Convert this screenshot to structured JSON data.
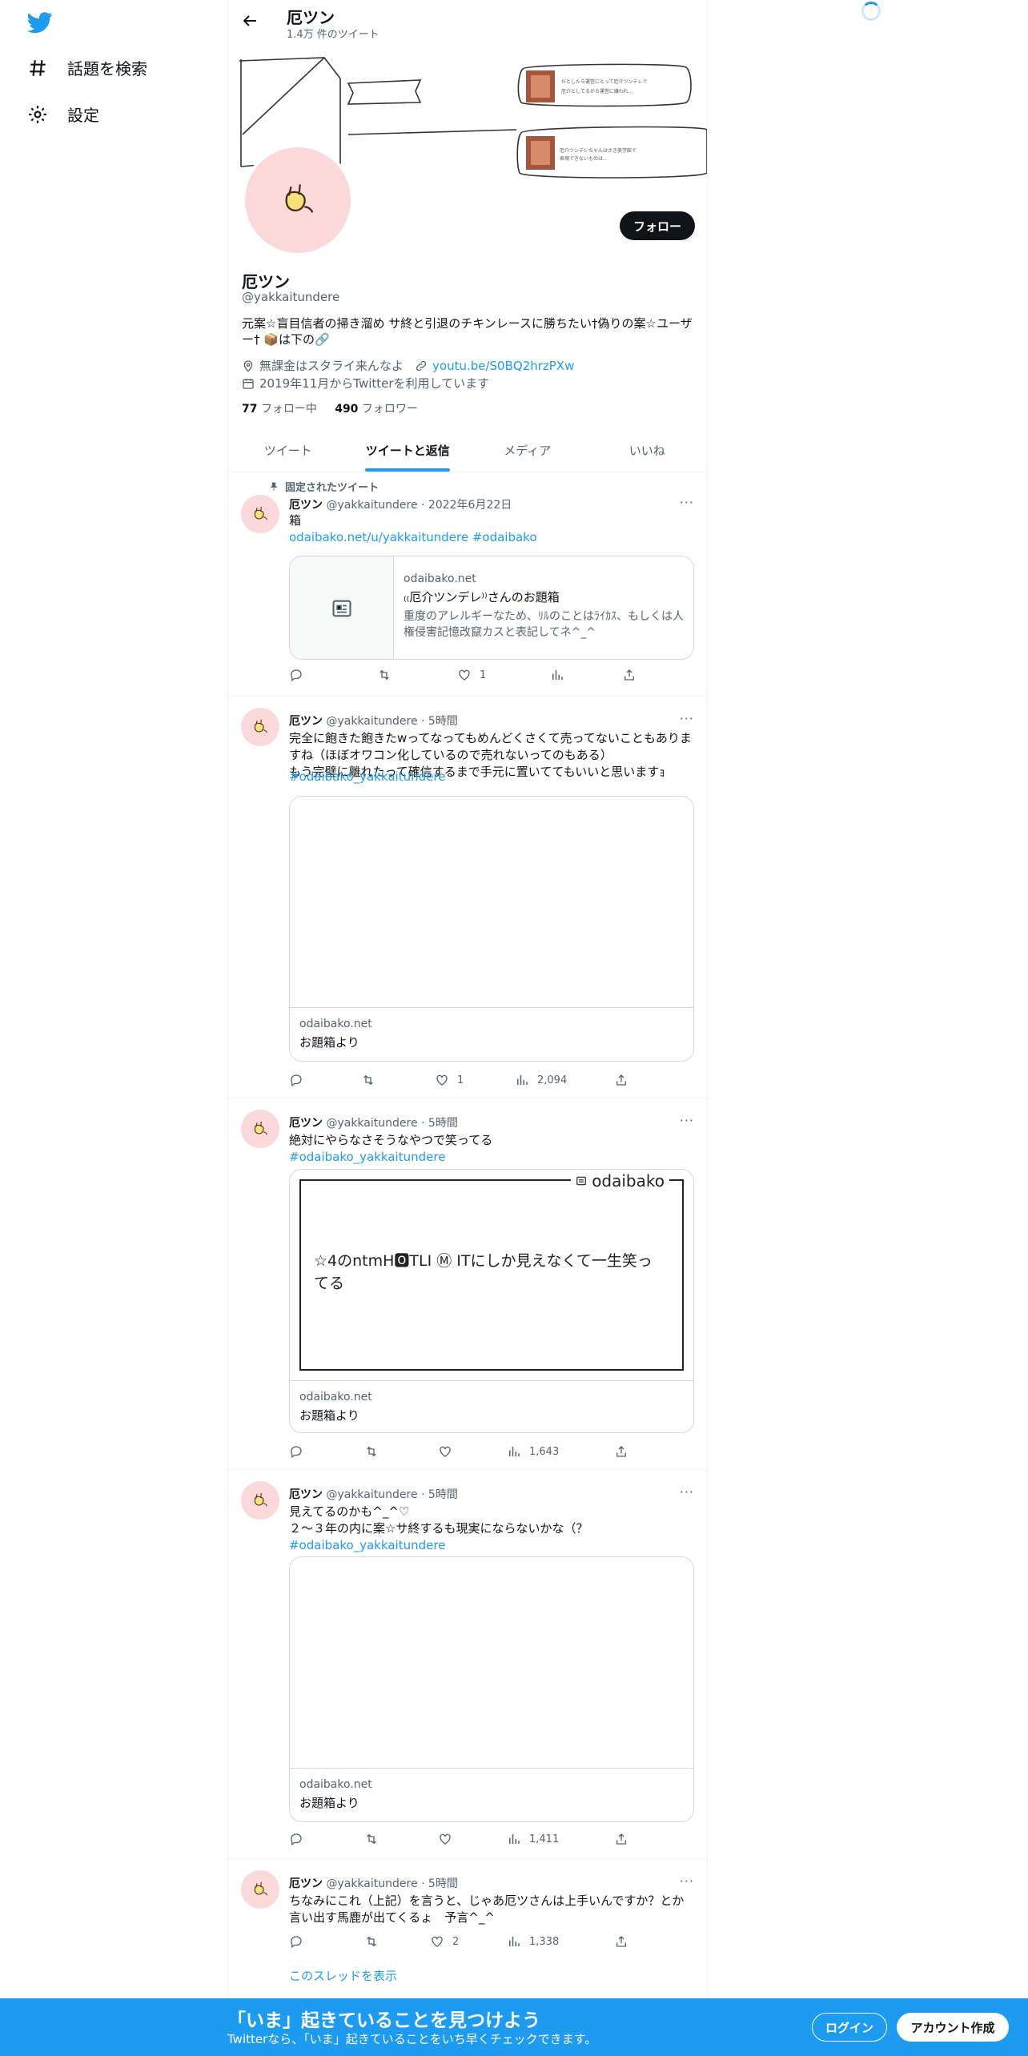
{
  "nav": {
    "items": [
      {
        "label": "話題を検索",
        "icon": "hashtag-icon"
      },
      {
        "label": "設定",
        "icon": "gear-icon"
      }
    ]
  },
  "header": {
    "title": "厄ツン",
    "tweet_count": "1.4万 件のツイート"
  },
  "profile": {
    "name": "厄ツン",
    "handle": "@yakkaitundere",
    "bio": "元案☆盲目信者の掃き溜め サ終と引退のチキンレースに勝ちたい†偽りの案☆ユーザー† 📦は下の🔗",
    "location": "無課金はスタライ来んなよ",
    "website": "youtu.be/S0BQ2hrzPXw",
    "joined": "2019年11月からTwitterを利用しています",
    "following_count": "77",
    "following_label": "フォロー中",
    "followers_count": "490",
    "followers_label": "フォロワー",
    "follow_button": "フォロー"
  },
  "tabs": [
    "ツイート",
    "ツイートと返信",
    "メディア",
    "いいね"
  ],
  "pinned_label": "固定されたツイート",
  "tweets": [
    {
      "name": "厄ツン",
      "handle": "@yakkaitundere",
      "time": "· 2022年6月22日",
      "text": "箱",
      "links": "odaibako.net/u/yakkaitundere #odaibako",
      "card_domain": "odaibako.net",
      "card_title": "₍₍厄介ツンデレ⁾⁾さんのお題箱",
      "card_desc": "重度のアレルギーなため、ﾘﾙのことはﾗｲｶｽ、もしくは人権侵害記憶改竄カスと表記してネ^_^",
      "replies": "",
      "retweets": "",
      "likes": "1",
      "views": "",
      "more": "···"
    },
    {
      "name": "厄ツン",
      "handle": "@yakkaitundere",
      "time": "· 5時間",
      "text": "完全に飽きた飽きたwってなってもめんどくさくて売ってないこともありますね（ほぼオワコン化しているので売れないってのもある）\nもう完璧に離れたって確信するまで手元に置いててもいいと思いますｮ",
      "links": "#odaibako_yakkaitundere",
      "card_domain": "odaibako.net",
      "card_title": "お題箱より",
      "replies": "",
      "retweets": "",
      "likes": "1",
      "views": "2,094",
      "more": "···"
    },
    {
      "name": "厄ツン",
      "handle": "@yakkaitundere",
      "time": "· 5時間",
      "text": "絶対にやらなさそうなやつで笑ってる",
      "links": "#odaibako_yakkaitundere",
      "card_image_brand": "odaibako",
      "card_image_text": "☆4のntmH🅾TLI Ⓜ ITにしか見えなくて一生笑ってる",
      "card_domain": "odaibako.net",
      "card_title": "お題箱より",
      "replies": "",
      "retweets": "",
      "likes": "",
      "views": "1,643",
      "more": "···"
    },
    {
      "name": "厄ツン",
      "handle": "@yakkaitundere",
      "time": "· 5時間",
      "text": "見えてるのかも^_^♡\n２〜３年の内に案☆サ終するも現実にならないかな（？",
      "links": "#odaibako_yakkaitundere",
      "card_domain": "odaibako.net",
      "card_title": "お題箱より",
      "replies": "",
      "retweets": "",
      "likes": "",
      "views": "1,411",
      "more": "···"
    },
    {
      "name": "厄ツン",
      "handle": "@yakkaitundere",
      "time": "· 5時間",
      "text": "ちなみにこれ（上記）を言うと、じゃあ厄ツさんは上手いんですか？とか言い出す馬鹿が出てくるょ　予言^_^",
      "replies": "",
      "retweets": "",
      "likes": "2",
      "views": "1,338",
      "more": "···"
    }
  ],
  "show_thread": "このスレッドを表示",
  "bottom_bar": {
    "title": "「いま」起きていることを見つけよう",
    "subtitle": "Twitterなら、「いま」起きていることをいち早くチェックできます。",
    "login": "ログイン",
    "signup": "アカウント作成"
  },
  "colors": {
    "accent": "#1d9bf0",
    "text": "#0f1419",
    "muted": "#536471"
  }
}
